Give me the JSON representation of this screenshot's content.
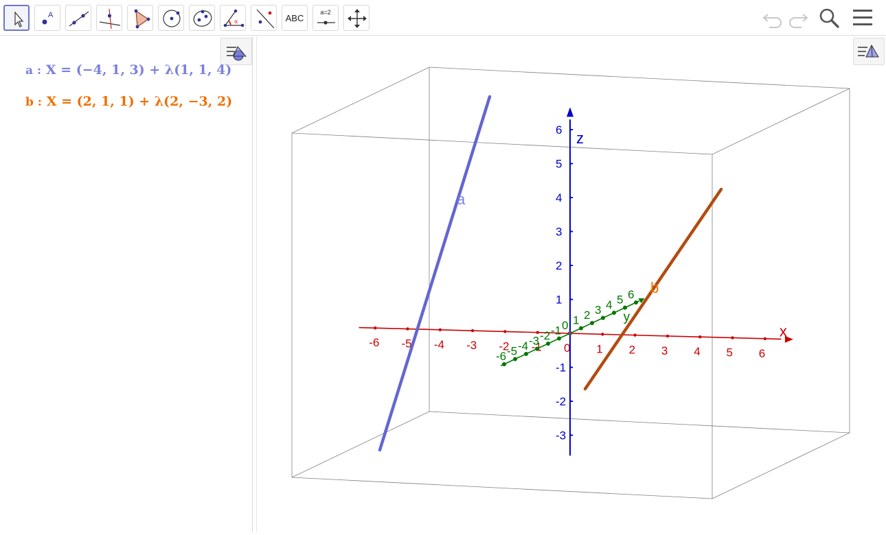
{
  "toolbar": {
    "tools": [
      {
        "name": "move-tool",
        "label": ""
      },
      {
        "name": "point-tool",
        "label": ""
      },
      {
        "name": "line-tool",
        "label": ""
      },
      {
        "name": "perpendicular-line-tool",
        "label": ""
      },
      {
        "name": "polygon-tool",
        "label": ""
      },
      {
        "name": "circle-tool",
        "label": ""
      },
      {
        "name": "ellipse-tool",
        "label": ""
      },
      {
        "name": "angle-tool",
        "label": ""
      },
      {
        "name": "reflect-tool",
        "label": ""
      },
      {
        "name": "text-tool",
        "label": "ABC"
      },
      {
        "name": "slider-tool",
        "label": "a=2"
      },
      {
        "name": "move-graphics-view-tool",
        "label": ""
      }
    ],
    "right_controls": [
      "undo-icon",
      "redo-icon",
      "search-icon",
      "menu-icon"
    ]
  },
  "algebra": {
    "items": [
      {
        "name": "a",
        "label": "a :",
        "expression": "X = (−4, 1, 3) + λ(1, 1, 4)",
        "color": "#7b7fe0"
      },
      {
        "name": "b",
        "label": "b :",
        "expression": "X = (2, 1, 1) + λ(2, −3, 2)",
        "color": "#f07000"
      }
    ]
  },
  "colors": {
    "x_axis": "#cc0000",
    "y_axis": "#007700",
    "z_axis": "#0000cc",
    "line_a": "#6466d0",
    "line_b": "#b24c10",
    "box": "#555555"
  },
  "view3d": {
    "axis_labels": {
      "x": "x",
      "y": "y",
      "z": "z"
    },
    "x_ticks": [
      "-6",
      "-5",
      "-4",
      "-3",
      "-2",
      "-1",
      "0",
      "1",
      "2",
      "3",
      "4",
      "5",
      "6"
    ],
    "y_ticks": [
      "-6",
      "-5",
      "-4",
      "-3",
      "-2",
      "-1",
      "0",
      "1",
      "2",
      "3",
      "4",
      "5",
      "6"
    ],
    "z_ticks": [
      "-3",
      "-2",
      "-1",
      "0",
      "1",
      "2",
      "3",
      "4",
      "5",
      "6"
    ],
    "line_a_label": "a",
    "line_b_label": "b"
  }
}
